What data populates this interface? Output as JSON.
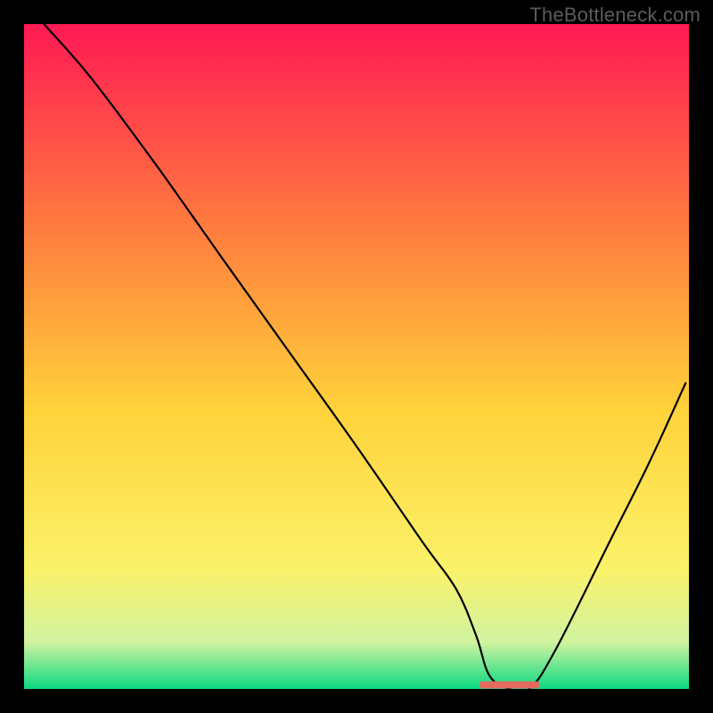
{
  "watermark": "TheBottleneck.com",
  "chart_data": {
    "type": "line",
    "title": "",
    "xlabel": "",
    "ylabel": "",
    "xlim": [
      0,
      100
    ],
    "ylim": [
      0,
      100
    ],
    "background_gradient": {
      "top": "#ff1954",
      "upper_mid": "#ff7a3f",
      "mid": "#ffd23a",
      "lower_mid": "#fbf26a",
      "near_bottom": "#d0f3a0",
      "bottom": "#0bd981"
    },
    "curve": {
      "description": "bottleneck deviation curve, V-shape with minimum near x≈70–76",
      "x": [
        3,
        10,
        19,
        24,
        30,
        40,
        50,
        60,
        65,
        68,
        70,
        73,
        76,
        80,
        88,
        94,
        99.5
      ],
      "y": [
        100,
        92,
        80,
        73,
        64.5,
        50.5,
        36.5,
        22,
        15,
        8,
        2,
        0,
        0,
        6,
        22,
        34,
        46
      ]
    },
    "marker": {
      "description": "salmon segment at curve minimum",
      "x_range": [
        68.5,
        77.5
      ],
      "y": 0.6,
      "color": "#e46a5e"
    },
    "frame_color": "#000000",
    "frame_thickness_px": 27
  }
}
